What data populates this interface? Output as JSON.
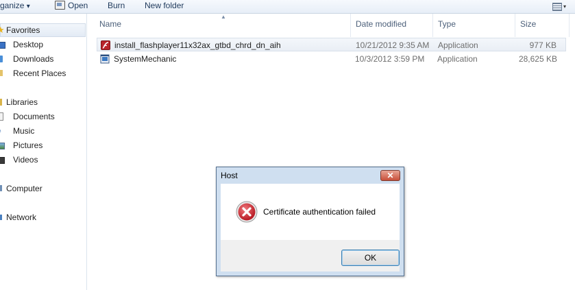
{
  "toolbar": {
    "organize_label": "ganize",
    "organize_caret": "▾",
    "open_label": "Open",
    "burn_label": "Burn",
    "new_folder_label": "New folder",
    "views_caret": "▾"
  },
  "nav": {
    "favorites_label": "Favorites",
    "desktop_label": "Desktop",
    "downloads_label": "Downloads",
    "recent_places_label": "Recent Places",
    "libraries_label": "Libraries",
    "documents_label": "Documents",
    "music_label": "Music",
    "pictures_label": "Pictures",
    "videos_label": "Videos",
    "computer_label": "Computer",
    "network_label": "Network"
  },
  "columns": {
    "name": "Name",
    "date_modified": "Date modified",
    "type": "Type",
    "size": "Size"
  },
  "files": [
    {
      "name": "install_flashplayer11x32ax_gtbd_chrd_dn_aih",
      "date": "10/21/2012 9:35 AM",
      "type": "Application",
      "size": "977 KB",
      "icon": "flash-installer-icon"
    },
    {
      "name": "SystemMechanic",
      "date": "10/3/2012 3:59 PM",
      "type": "Application",
      "size": "28,625 KB",
      "icon": "application-icon"
    }
  ],
  "dialog": {
    "title": "Host",
    "close_glyph": "✕",
    "message": "Certificate authentication failed",
    "ok_label": "OK",
    "icon": "error-icon"
  },
  "colors": {
    "error_red": "#c8202a",
    "dialog_frame": "#cfdff0",
    "close_red": "#c8503a",
    "toolbar_text": "#1e395b"
  }
}
